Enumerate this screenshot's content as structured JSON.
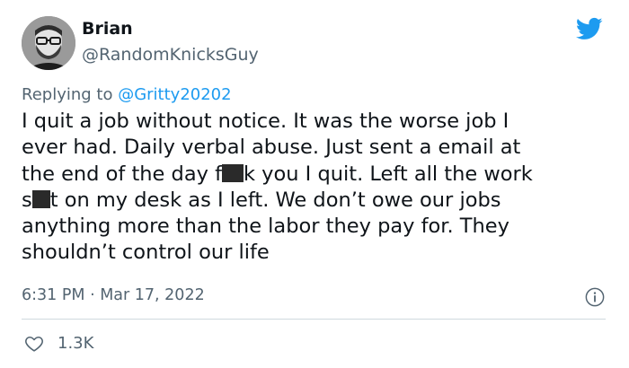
{
  "user": {
    "display_name": "Brian",
    "handle": "@RandomKnicksGuy"
  },
  "reply": {
    "prefix": "Replying to ",
    "mention": "@Gritty20202"
  },
  "tweet": {
    "line1": "I quit a job without notice. It was the worse job I",
    "line2": "ever had. Daily verbal abuse. Just sent a email at",
    "line3_part1": "the end of the day f",
    "line3_part2": "k you I quit. Left all the work",
    "line4_part1": "s",
    "line4_part2": "t on my desk as I left. We don’t owe our jobs",
    "line5": "anything more than the labor they pay for. They",
    "line6": "shouldn’t control our life"
  },
  "meta": {
    "timestamp": "6:31 PM · Mar 17, 2022"
  },
  "stats": {
    "likes": "1.3K"
  },
  "colors": {
    "brand_blue": "#1d9bf0",
    "secondary_text": "#536471",
    "divider": "#cfd9de"
  },
  "icons": {
    "logo": "twitter-bird-icon",
    "info": "info-icon",
    "like": "heart-icon"
  }
}
